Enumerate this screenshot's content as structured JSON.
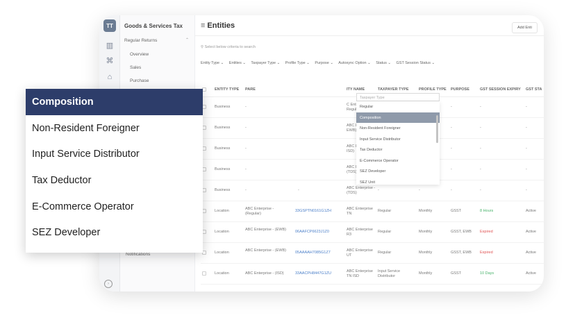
{
  "sidebar": {
    "logo": "TT",
    "app_title": "Goods & Services Tax",
    "section": "Regular Returns",
    "items": [
      "Overview",
      "Sales",
      "Purchase"
    ],
    "footer_item": "Notifications"
  },
  "main": {
    "title_icon": "≡",
    "title": "Entities",
    "add_button": "Add Enti",
    "search_hint": "Select below criteria to search",
    "filters": [
      "Entity Type ⌄",
      "Entities ⌄",
      "Taxpayer Type ⌄",
      "Profile Type ⌄",
      "Purpose ⌄",
      "Autosync Option ⌄",
      "Status ⌄",
      "GST Session Status ⌄"
    ]
  },
  "table": {
    "headers": [
      "ENTITY TYPE",
      "PARE",
      "ITY NAME",
      "TAXPAYER TYPE",
      "PROFILE TYPE",
      "PURPOSE",
      "GST SESSION EXPIRY",
      "GST STA"
    ],
    "rows": [
      {
        "type": "Business",
        "parent": "-",
        "gstin": "",
        "name": "C Enterprise - Regular)",
        "taxpayer": "-",
        "profile": "-",
        "purpose": "-",
        "expiry": "-",
        "status": "-"
      },
      {
        "type": "Business",
        "parent": "-",
        "gstin": "",
        "name": "ABC Enterprise - EWB)",
        "taxpayer": "-",
        "profile": "-",
        "purpose": "-",
        "expiry": "-",
        "status": "-"
      },
      {
        "type": "Business",
        "parent": "-",
        "gstin": "",
        "name": "ABC Enterprise - ISD)",
        "taxpayer": "-",
        "profile": "-",
        "purpose": "-",
        "expiry": "-",
        "status": "-"
      },
      {
        "type": "Business",
        "parent": "-",
        "gstin": "",
        "name": "ABC Enterprise - (TDS)",
        "taxpayer": "-",
        "profile": "-",
        "purpose": "-",
        "expiry": "-",
        "status": "-"
      },
      {
        "type": "Business",
        "parent": "-",
        "gstin": "-",
        "name": "ABC Enterprise - (TDS)",
        "taxpayer": "-",
        "profile": "-",
        "purpose": "-",
        "expiry": "-",
        "status": "-"
      },
      {
        "type": "Location",
        "parent": "ABC Enterprise - (Regular)",
        "gstin": "33GSPTN0161G1ZH",
        "name": "ABC Enterprise TN",
        "taxpayer": "Regular",
        "profile": "Monthly",
        "purpose": "GSST",
        "expiry": "8 Hours",
        "status": "Active"
      },
      {
        "type": "Location",
        "parent": "ABC Enterprise - (EWB)",
        "gstin": "06AAFCP6623J1Z0",
        "name": "ABC Enterprise R3",
        "taxpayer": "Regular",
        "profile": "Monthly",
        "purpose": "GSST, EWB",
        "expiry": "Expired",
        "status": "Active"
      },
      {
        "type": "Location",
        "parent": "ABC Enterprise - (EWB)",
        "gstin": "05AAAAH7085G1Z7",
        "name": "ABC Enterprise UT",
        "taxpayer": "Regular",
        "profile": "Monthly",
        "purpose": "GSST, EWB",
        "expiry": "Expired",
        "status": "Active"
      },
      {
        "type": "Location",
        "parent": "ABC Enterprise - (ISD)",
        "gstin": "33AACPH8447G1ZU",
        "name": "ABC Enterprise TN ISD",
        "taxpayer": "Input Service Distributor",
        "profile": "Monthly",
        "purpose": "GSST",
        "expiry": "10 Days",
        "status": "Active"
      }
    ]
  },
  "dropdown": {
    "placeholder": "Taxpayer Type",
    "options": [
      "Regular",
      "Composition",
      "Non-Resident Foreigner",
      "Input Service Distributor",
      "Tax Deductor",
      "E-Commerce Operator",
      "SEZ Developer",
      "SEZ Unit"
    ],
    "selected_index": 1
  },
  "popup": {
    "options": [
      "Composition",
      "Non-Resident Foreigner",
      "Input Service Distributor",
      "Tax Deductor",
      "E-Commerce Operator",
      "SEZ Developer"
    ],
    "selected_index": 0
  },
  "colors": {
    "popup_selected": "#2d3d6a",
    "expiry_ok": "#49b36b",
    "expiry_bad": "#e05555",
    "gstin": "#4b7fc9"
  }
}
